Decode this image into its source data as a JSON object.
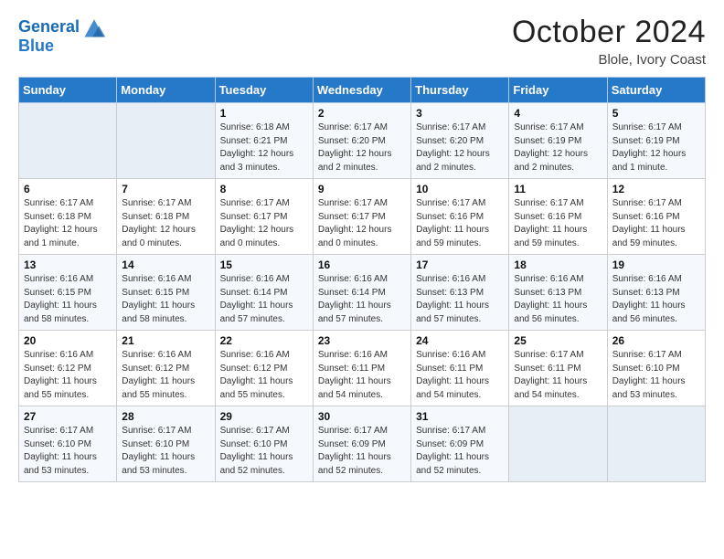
{
  "header": {
    "logo_line1": "General",
    "logo_line2": "Blue",
    "month": "October 2024",
    "location": "Blole, Ivory Coast"
  },
  "weekdays": [
    "Sunday",
    "Monday",
    "Tuesday",
    "Wednesday",
    "Thursday",
    "Friday",
    "Saturday"
  ],
  "weeks": [
    [
      {
        "day": "",
        "info": ""
      },
      {
        "day": "",
        "info": ""
      },
      {
        "day": "1",
        "info": "Sunrise: 6:18 AM\nSunset: 6:21 PM\nDaylight: 12 hours and 3 minutes."
      },
      {
        "day": "2",
        "info": "Sunrise: 6:17 AM\nSunset: 6:20 PM\nDaylight: 12 hours and 2 minutes."
      },
      {
        "day": "3",
        "info": "Sunrise: 6:17 AM\nSunset: 6:20 PM\nDaylight: 12 hours and 2 minutes."
      },
      {
        "day": "4",
        "info": "Sunrise: 6:17 AM\nSunset: 6:19 PM\nDaylight: 12 hours and 2 minutes."
      },
      {
        "day": "5",
        "info": "Sunrise: 6:17 AM\nSunset: 6:19 PM\nDaylight: 12 hours and 1 minute."
      }
    ],
    [
      {
        "day": "6",
        "info": "Sunrise: 6:17 AM\nSunset: 6:18 PM\nDaylight: 12 hours and 1 minute."
      },
      {
        "day": "7",
        "info": "Sunrise: 6:17 AM\nSunset: 6:18 PM\nDaylight: 12 hours and 0 minutes."
      },
      {
        "day": "8",
        "info": "Sunrise: 6:17 AM\nSunset: 6:17 PM\nDaylight: 12 hours and 0 minutes."
      },
      {
        "day": "9",
        "info": "Sunrise: 6:17 AM\nSunset: 6:17 PM\nDaylight: 12 hours and 0 minutes."
      },
      {
        "day": "10",
        "info": "Sunrise: 6:17 AM\nSunset: 6:16 PM\nDaylight: 11 hours and 59 minutes."
      },
      {
        "day": "11",
        "info": "Sunrise: 6:17 AM\nSunset: 6:16 PM\nDaylight: 11 hours and 59 minutes."
      },
      {
        "day": "12",
        "info": "Sunrise: 6:17 AM\nSunset: 6:16 PM\nDaylight: 11 hours and 59 minutes."
      }
    ],
    [
      {
        "day": "13",
        "info": "Sunrise: 6:16 AM\nSunset: 6:15 PM\nDaylight: 11 hours and 58 minutes."
      },
      {
        "day": "14",
        "info": "Sunrise: 6:16 AM\nSunset: 6:15 PM\nDaylight: 11 hours and 58 minutes."
      },
      {
        "day": "15",
        "info": "Sunrise: 6:16 AM\nSunset: 6:14 PM\nDaylight: 11 hours and 57 minutes."
      },
      {
        "day": "16",
        "info": "Sunrise: 6:16 AM\nSunset: 6:14 PM\nDaylight: 11 hours and 57 minutes."
      },
      {
        "day": "17",
        "info": "Sunrise: 6:16 AM\nSunset: 6:13 PM\nDaylight: 11 hours and 57 minutes."
      },
      {
        "day": "18",
        "info": "Sunrise: 6:16 AM\nSunset: 6:13 PM\nDaylight: 11 hours and 56 minutes."
      },
      {
        "day": "19",
        "info": "Sunrise: 6:16 AM\nSunset: 6:13 PM\nDaylight: 11 hours and 56 minutes."
      }
    ],
    [
      {
        "day": "20",
        "info": "Sunrise: 6:16 AM\nSunset: 6:12 PM\nDaylight: 11 hours and 55 minutes."
      },
      {
        "day": "21",
        "info": "Sunrise: 6:16 AM\nSunset: 6:12 PM\nDaylight: 11 hours and 55 minutes."
      },
      {
        "day": "22",
        "info": "Sunrise: 6:16 AM\nSunset: 6:12 PM\nDaylight: 11 hours and 55 minutes."
      },
      {
        "day": "23",
        "info": "Sunrise: 6:16 AM\nSunset: 6:11 PM\nDaylight: 11 hours and 54 minutes."
      },
      {
        "day": "24",
        "info": "Sunrise: 6:16 AM\nSunset: 6:11 PM\nDaylight: 11 hours and 54 minutes."
      },
      {
        "day": "25",
        "info": "Sunrise: 6:17 AM\nSunset: 6:11 PM\nDaylight: 11 hours and 54 minutes."
      },
      {
        "day": "26",
        "info": "Sunrise: 6:17 AM\nSunset: 6:10 PM\nDaylight: 11 hours and 53 minutes."
      }
    ],
    [
      {
        "day": "27",
        "info": "Sunrise: 6:17 AM\nSunset: 6:10 PM\nDaylight: 11 hours and 53 minutes."
      },
      {
        "day": "28",
        "info": "Sunrise: 6:17 AM\nSunset: 6:10 PM\nDaylight: 11 hours and 53 minutes."
      },
      {
        "day": "29",
        "info": "Sunrise: 6:17 AM\nSunset: 6:10 PM\nDaylight: 11 hours and 52 minutes."
      },
      {
        "day": "30",
        "info": "Sunrise: 6:17 AM\nSunset: 6:09 PM\nDaylight: 11 hours and 52 minutes."
      },
      {
        "day": "31",
        "info": "Sunrise: 6:17 AM\nSunset: 6:09 PM\nDaylight: 11 hours and 52 minutes."
      },
      {
        "day": "",
        "info": ""
      },
      {
        "day": "",
        "info": ""
      }
    ]
  ]
}
